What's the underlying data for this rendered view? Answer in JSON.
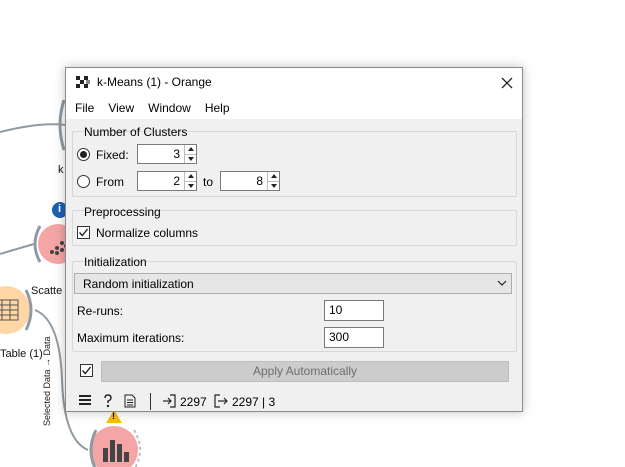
{
  "window": {
    "title": "k-Means (1) - Orange",
    "close_glyph": "✕"
  },
  "menu": {
    "items": [
      "File",
      "View",
      "Window",
      "Help"
    ]
  },
  "clusters": {
    "group_title": "Number of Clusters",
    "fixed_label": "Fixed:",
    "fixed_value": "3",
    "from_label": "From",
    "from_value": "2",
    "to_label": "to",
    "to_value": "8",
    "selected": "fixed"
  },
  "preprocessing": {
    "group_title": "Preprocessing",
    "normalize_label": "Normalize columns",
    "normalize_checked": true
  },
  "initialization": {
    "group_title": "Initialization",
    "method": "Random initialization",
    "reruns_label": "Re-runs:",
    "reruns_value": "10",
    "maxiter_label": "Maximum iterations:",
    "maxiter_value": "300"
  },
  "apply": {
    "label": "Apply Automatically",
    "auto_checked": true
  },
  "status": {
    "input_count": "2297",
    "output_count": "2297 | 3"
  },
  "canvas": {
    "widget_labels": {
      "kmeans_partial": "k",
      "scatter_partial": "Scatte",
      "table_partial": "Table (1)"
    },
    "link_label": "Selected Data → Data",
    "info_glyph": "i",
    "warning_glyph": "!"
  },
  "colors": {
    "link_gray": "#8f9aa3",
    "widget_fill": "#f4a6a6",
    "table_fill": "#ffd6a5",
    "info_blue": "#1a62b0",
    "warning_yellow": "#f6c000"
  }
}
